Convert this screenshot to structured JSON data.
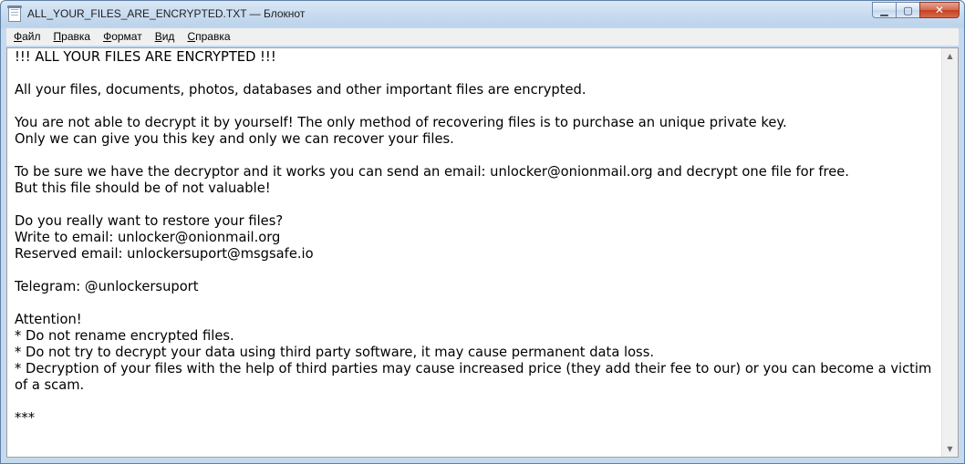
{
  "window": {
    "title": "ALL_YOUR_FILES_ARE_ENCRYPTED.TXT — Блокнот",
    "controls": {
      "minimize": "▁",
      "maximize": "▢",
      "close": "✕"
    }
  },
  "menu": {
    "items": [
      {
        "mnemonic": "Ф",
        "rest": "айл"
      },
      {
        "mnemonic": "П",
        "rest": "равка"
      },
      {
        "mnemonic": "Ф",
        "rest": "ормат"
      },
      {
        "mnemonic": "В",
        "rest": "ид"
      },
      {
        "mnemonic": "С",
        "rest": "правка"
      }
    ]
  },
  "document": {
    "text": "!!! ALL YOUR FILES ARE ENCRYPTED !!!\n\nAll your files, documents, photos, databases and other important files are encrypted.\n\nYou are not able to decrypt it by yourself! The only method of recovering files is to purchase an unique private key.\nOnly we can give you this key and only we can recover your files.\n\nTo be sure we have the decryptor and it works you can send an email: unlocker@onionmail.org and decrypt one file for free.\nBut this file should be of not valuable!\n\nDo you really want to restore your files?\nWrite to email: unlocker@onionmail.org\nReserved email: unlockersuport@msgsafe.io\n\nTelegram: @unlockersuport\n\nAttention!\n* Do not rename encrypted files.\n* Do not try to decrypt your data using third party software, it may cause permanent data loss.\n* Decryption of your files with the help of third parties may cause increased price (they add their fee to our) or you can become a victim of a scam.\n\n***"
  },
  "scrollbar": {
    "up": "▲",
    "down": "▼"
  }
}
